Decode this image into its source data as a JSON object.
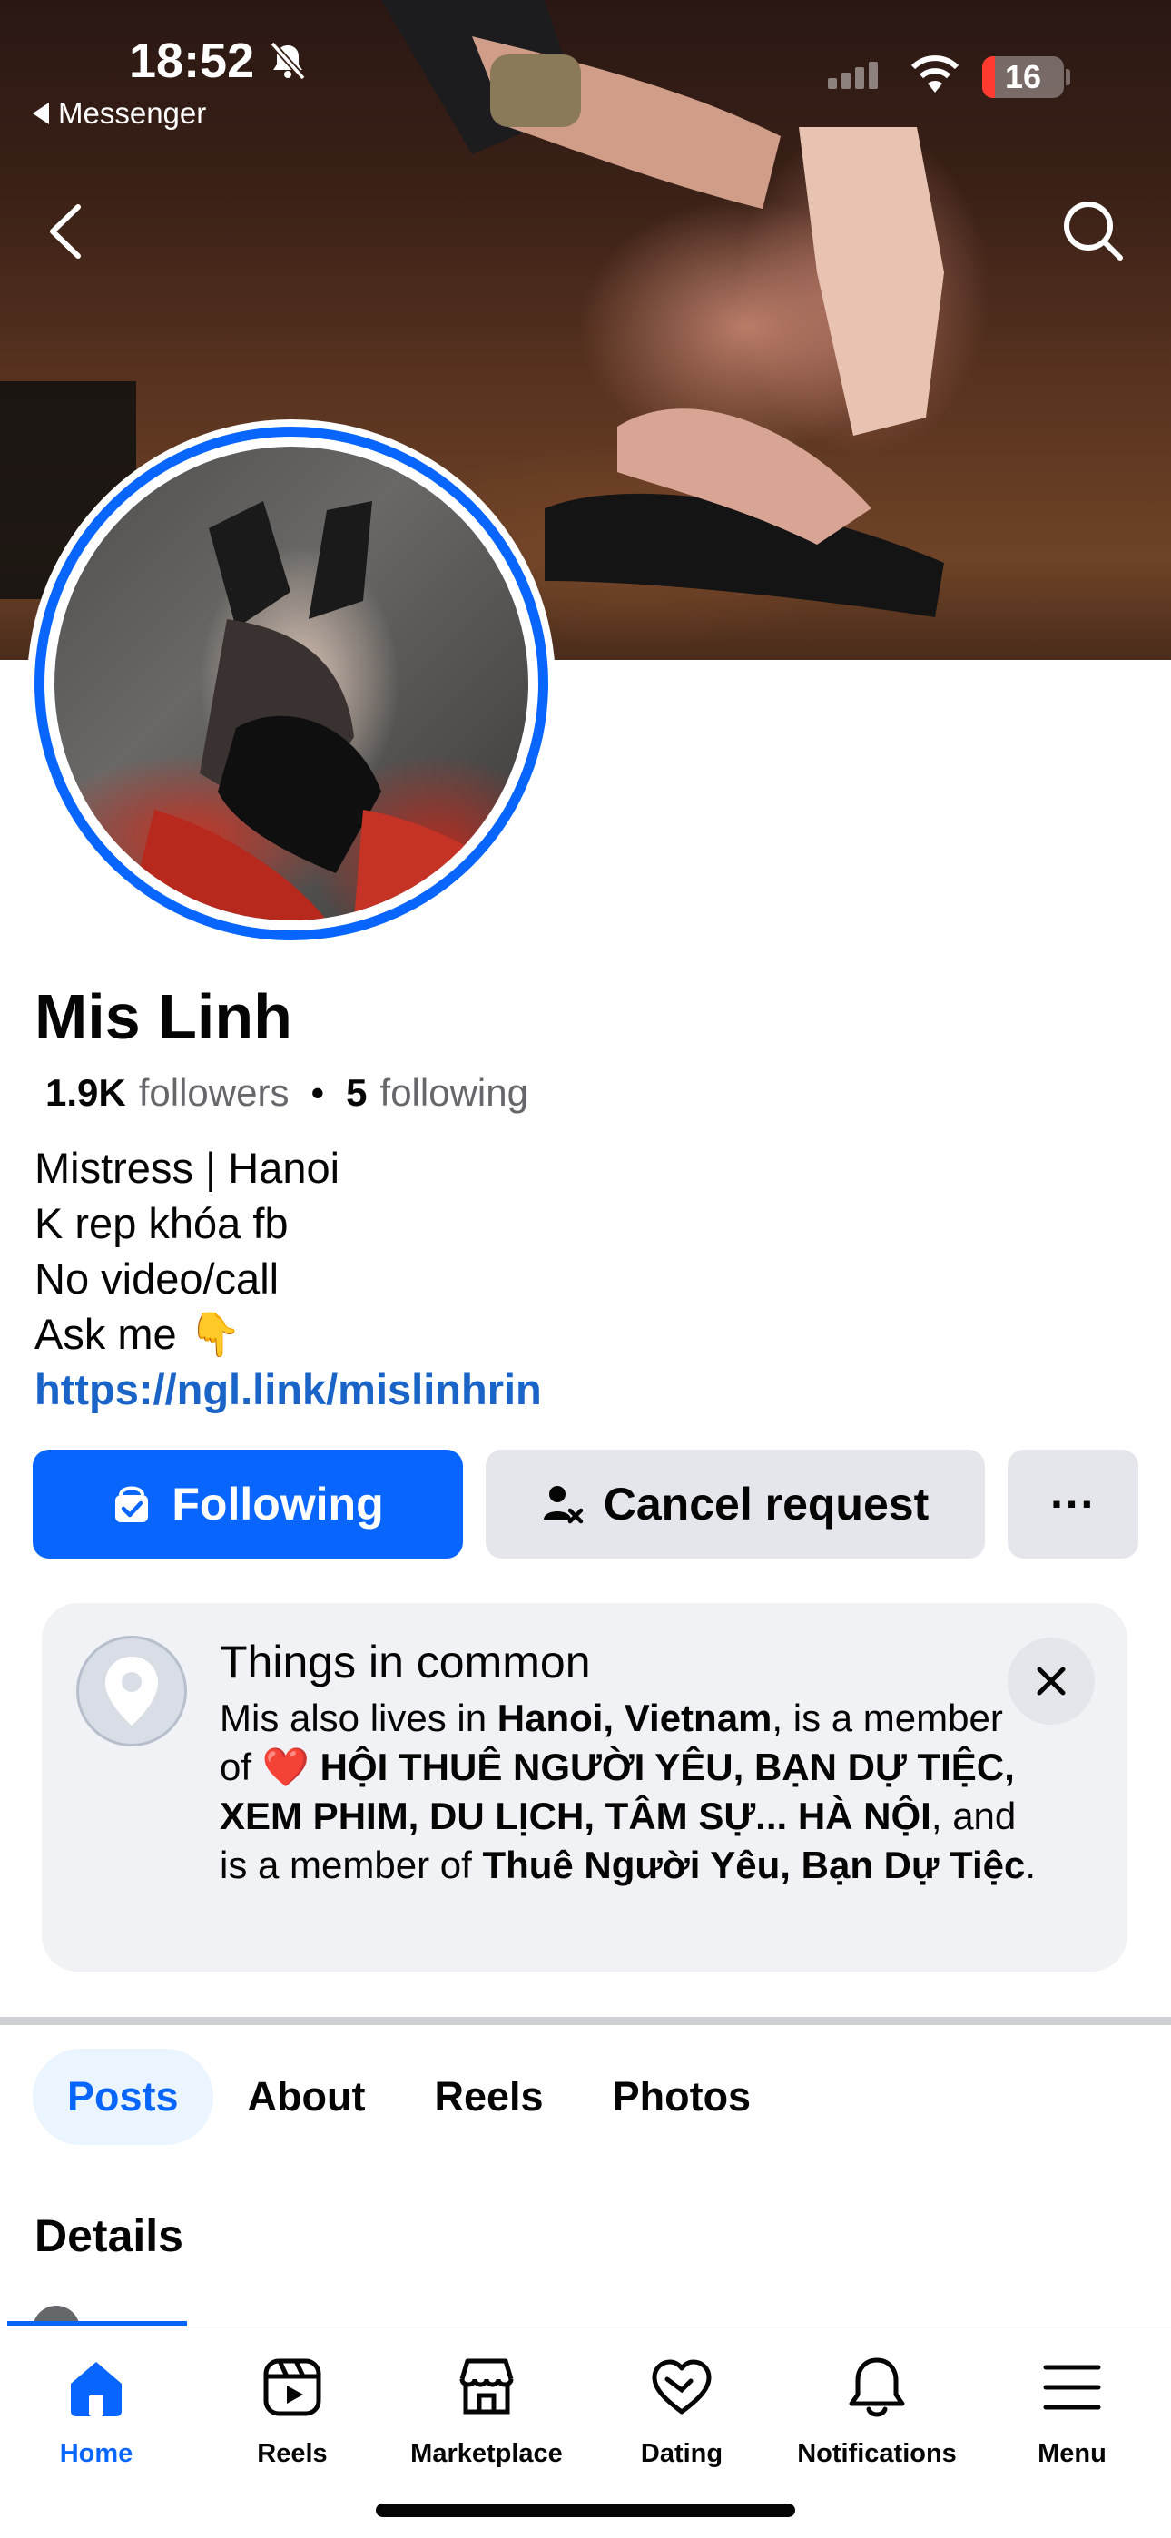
{
  "status_bar": {
    "time": "18:52",
    "back_app": "Messenger",
    "battery": "16",
    "battery_level": 0.16
  },
  "profile": {
    "name": "Mis Linh",
    "followers_count": "1.9K",
    "followers_label": "followers",
    "following_count": "5",
    "following_label": "following",
    "bio_lines": [
      "Mistress | Hanoi",
      "K rep khóa fb",
      "No video/call",
      "Ask me 👇"
    ],
    "link": "https://ngl.link/mislinhrin"
  },
  "actions": {
    "following": "Following",
    "cancel_request": "Cancel request",
    "more": "···"
  },
  "common": {
    "title": "Things in common",
    "t1": "Mis also lives in ",
    "b1": "Hanoi, Vietnam",
    "t2": ", is a member of ",
    "emoji": "❤️",
    "b2": " HỘI THUÊ NGƯỜI YÊU, BẠN DỰ TIỆC, XEM PHIM, DU LỊCH, TÂM SỰ... HÀ NỘI",
    "t3": ", and is a member of ",
    "b3": "Thuê Người Yêu, Bạn Dự Tiệc",
    "t4": "."
  },
  "tabs": [
    "Posts",
    "About",
    "Reels",
    "Photos"
  ],
  "section_title": "Details",
  "bottom_nav": [
    "Home",
    "Reels",
    "Marketplace",
    "Dating",
    "Notifications",
    "Menu"
  ],
  "colors": {
    "accent": "#0866ff",
    "link": "#1a64c8",
    "secondary_text": "#65676b"
  }
}
